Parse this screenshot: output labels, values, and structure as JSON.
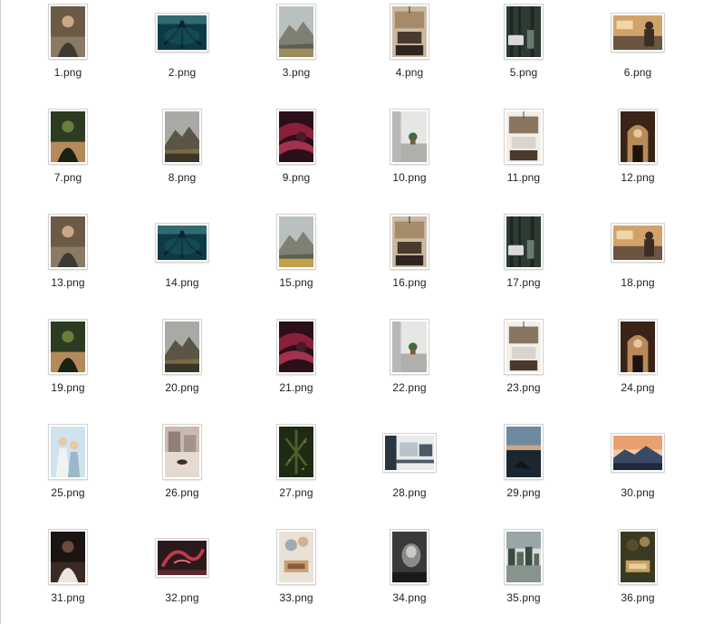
{
  "window": {
    "title": ""
  },
  "files": [
    {
      "name": "1.png",
      "orientation": "portrait",
      "palette": [
        "#6b5a45",
        "#c9a883",
        "#3d3a33",
        "#8a7a65"
      ],
      "art": "person"
    },
    {
      "name": "2.png",
      "orientation": "landscape",
      "palette": [
        "#0d3a44",
        "#1f6a73",
        "#0a2329",
        "#4a8a90"
      ],
      "art": "water"
    },
    {
      "name": "3.png",
      "orientation": "portrait",
      "palette": [
        "#b9c0bd",
        "#7f7f73",
        "#5d604f",
        "#9b8c5e"
      ],
      "art": "mountain"
    },
    {
      "name": "4.png",
      "orientation": "portrait",
      "palette": [
        "#4a3a2e",
        "#a68b6b",
        "#2e2520",
        "#c9b9a0"
      ],
      "art": "room"
    },
    {
      "name": "5.png",
      "orientation": "portrait",
      "palette": [
        "#2e3b33",
        "#6a7a6f",
        "#d9d9d9",
        "#1d2621"
      ],
      "art": "forest"
    },
    {
      "name": "6.png",
      "orientation": "landscape",
      "palette": [
        "#d1a36a",
        "#3a2e24",
        "#6b5440",
        "#f0d6a8"
      ],
      "art": "kitchen"
    },
    {
      "name": "7.png",
      "orientation": "portrait",
      "palette": [
        "#2c3b22",
        "#6a7f3a",
        "#1b2214",
        "#b48a5a"
      ],
      "art": "person"
    },
    {
      "name": "8.png",
      "orientation": "portrait",
      "palette": [
        "#a9a9a5",
        "#5a5544",
        "#7a6b45",
        "#3a3628"
      ],
      "art": "mountain"
    },
    {
      "name": "9.png",
      "orientation": "portrait",
      "palette": [
        "#2b0f1a",
        "#8a1f3a",
        "#4a1a2a",
        "#c03a5a"
      ],
      "art": "swirl"
    },
    {
      "name": "10.png",
      "orientation": "portrait",
      "palette": [
        "#e6e6e4",
        "#b8b8b5",
        "#3d6b3a",
        "#8a8a86"
      ],
      "art": "plant"
    },
    {
      "name": "11.png",
      "orientation": "portrait",
      "palette": [
        "#d9d4cc",
        "#8a7560",
        "#4a3a2e",
        "#f2efe9"
      ],
      "art": "room"
    },
    {
      "name": "12.png",
      "orientation": "portrait",
      "palette": [
        "#3a2418",
        "#b88a5a",
        "#1f130c",
        "#e6c9a0"
      ],
      "art": "arch"
    },
    {
      "name": "13.png",
      "orientation": "portrait",
      "palette": [
        "#6b5a45",
        "#c9a883",
        "#3d3a33",
        "#8a7a65"
      ],
      "art": "person"
    },
    {
      "name": "14.png",
      "orientation": "landscape",
      "palette": [
        "#0d3a44",
        "#1f6a73",
        "#0a2329",
        "#4a8a90"
      ],
      "art": "water"
    },
    {
      "name": "15.png",
      "orientation": "portrait",
      "palette": [
        "#b9c0bd",
        "#7f7f73",
        "#5d604f",
        "#c2a04a"
      ],
      "art": "mountain"
    },
    {
      "name": "16.png",
      "orientation": "portrait",
      "palette": [
        "#4a3a2e",
        "#a68b6b",
        "#2e2520",
        "#c9b9a0"
      ],
      "art": "room"
    },
    {
      "name": "17.png",
      "orientation": "portrait",
      "palette": [
        "#2e3b33",
        "#6a7a6f",
        "#d9d9d9",
        "#1d2621"
      ],
      "art": "forest"
    },
    {
      "name": "18.png",
      "orientation": "landscape",
      "palette": [
        "#d1a36a",
        "#3a2e24",
        "#6b5440",
        "#f0d6a8"
      ],
      "art": "kitchen"
    },
    {
      "name": "19.png",
      "orientation": "portrait",
      "palette": [
        "#2c3b22",
        "#6a7f3a",
        "#1b2214",
        "#b48a5a"
      ],
      "art": "person"
    },
    {
      "name": "20.png",
      "orientation": "portrait",
      "palette": [
        "#a9a9a5",
        "#5a5544",
        "#7a6b45",
        "#3a3628"
      ],
      "art": "mountain"
    },
    {
      "name": "21.png",
      "orientation": "portrait",
      "palette": [
        "#2b0f1a",
        "#8a1f3a",
        "#4a1a2a",
        "#c03a5a"
      ],
      "art": "swirl"
    },
    {
      "name": "22.png",
      "orientation": "portrait",
      "palette": [
        "#e6e6e4",
        "#b8b8b5",
        "#3d6b3a",
        "#8a8a86"
      ],
      "art": "plant"
    },
    {
      "name": "23.png",
      "orientation": "portrait",
      "palette": [
        "#d9d4cc",
        "#8a7560",
        "#4a3a2e",
        "#f2efe9"
      ],
      "art": "room"
    },
    {
      "name": "24.png",
      "orientation": "portrait",
      "palette": [
        "#3a2418",
        "#b88a5a",
        "#1f130c",
        "#e6c9a0"
      ],
      "art": "arch"
    },
    {
      "name": "25.png",
      "orientation": "portrait",
      "palette": [
        "#cfe3ee",
        "#e8c9a0",
        "#f2f2f2",
        "#9ab8c9"
      ],
      "art": "people"
    },
    {
      "name": "26.png",
      "orientation": "portrait",
      "palette": [
        "#c9b9b0",
        "#6a5a55",
        "#e6d9d0",
        "#3a2e2a"
      ],
      "art": "street"
    },
    {
      "name": "27.png",
      "orientation": "portrait",
      "palette": [
        "#1f2a14",
        "#4a5f2a",
        "#0f160a",
        "#8a6a3a"
      ],
      "art": "leaves"
    },
    {
      "name": "28.png",
      "orientation": "landscape",
      "palette": [
        "#e9eaea",
        "#4a5a66",
        "#b9c2c9",
        "#2a3540"
      ],
      "art": "desk"
    },
    {
      "name": "29.png",
      "orientation": "portrait",
      "palette": [
        "#1a2630",
        "#c9a58a",
        "#3a4a55",
        "#0f161c"
      ],
      "art": "sea"
    },
    {
      "name": "30.png",
      "orientation": "landscape",
      "palette": [
        "#e9a070",
        "#3a4a66",
        "#f2c9a0",
        "#1f2a3a"
      ],
      "art": "sunset"
    },
    {
      "name": "31.png",
      "orientation": "portrait",
      "palette": [
        "#1a1412",
        "#6a4a3a",
        "#e9e6e2",
        "#3a2a22"
      ],
      "art": "person"
    },
    {
      "name": "32.png",
      "orientation": "landscape",
      "palette": [
        "#2a1a1c",
        "#c03a4a",
        "#5a2a30",
        "#f07080"
      ],
      "art": "neon"
    },
    {
      "name": "33.png",
      "orientation": "portrait",
      "palette": [
        "#e9e2d6",
        "#c9a070",
        "#6a8a9a",
        "#8a5a3a"
      ],
      "art": "table"
    },
    {
      "name": "34.png",
      "orientation": "portrait",
      "palette": [
        "#3a3a3a",
        "#8a8a88",
        "#1a1a1a",
        "#c9c9c6"
      ],
      "art": "statue"
    },
    {
      "name": "35.png",
      "orientation": "portrait",
      "palette": [
        "#9aa5a8",
        "#3a4a44",
        "#d9dcd9",
        "#5a6a60"
      ],
      "art": "city"
    },
    {
      "name": "36.png",
      "orientation": "portrait",
      "palette": [
        "#3a3a22",
        "#c9a060",
        "#6a5a30",
        "#e6d0a0"
      ],
      "art": "table"
    }
  ]
}
